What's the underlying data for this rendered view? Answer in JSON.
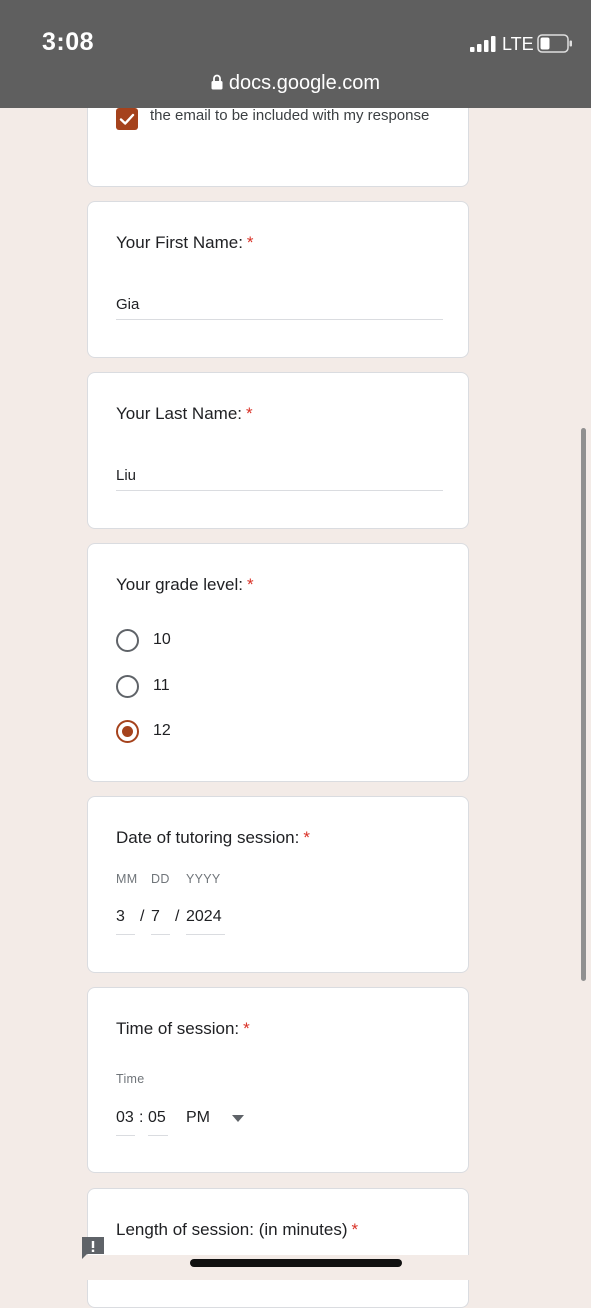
{
  "status_bar": {
    "time": "3:08",
    "network": "LTE",
    "url": "docs.google.com"
  },
  "colors": {
    "accent": "#a5421c",
    "required": "#d93025",
    "background": "#f3ebe7",
    "status_bar": "#5f5f5f"
  },
  "email_consent": {
    "checked": true,
    "text": "the email to be included with my response"
  },
  "first_name": {
    "label": "Your First Name:",
    "required_mark": "*",
    "value": "Gia"
  },
  "last_name": {
    "label": "Your Last Name:",
    "required_mark": "*",
    "value": "Liu"
  },
  "grade": {
    "label": "Your grade level:",
    "required_mark": "*",
    "options": [
      {
        "label": "10",
        "selected": false
      },
      {
        "label": "11",
        "selected": false
      },
      {
        "label": "12",
        "selected": true
      }
    ]
  },
  "date": {
    "label": "Date of tutoring session:",
    "required_mark": "*",
    "month_label": "MM",
    "day_label": "DD",
    "year_label": "YYYY",
    "month": "3",
    "day": "7",
    "year": "2024",
    "separator": "/"
  },
  "time": {
    "label": "Time of session:",
    "required_mark": "*",
    "sub_label": "Time",
    "hour": "03",
    "minute": "05",
    "separator": ":",
    "period": "PM"
  },
  "length": {
    "label": "Length of session: (in minutes)",
    "required_mark": "*"
  }
}
